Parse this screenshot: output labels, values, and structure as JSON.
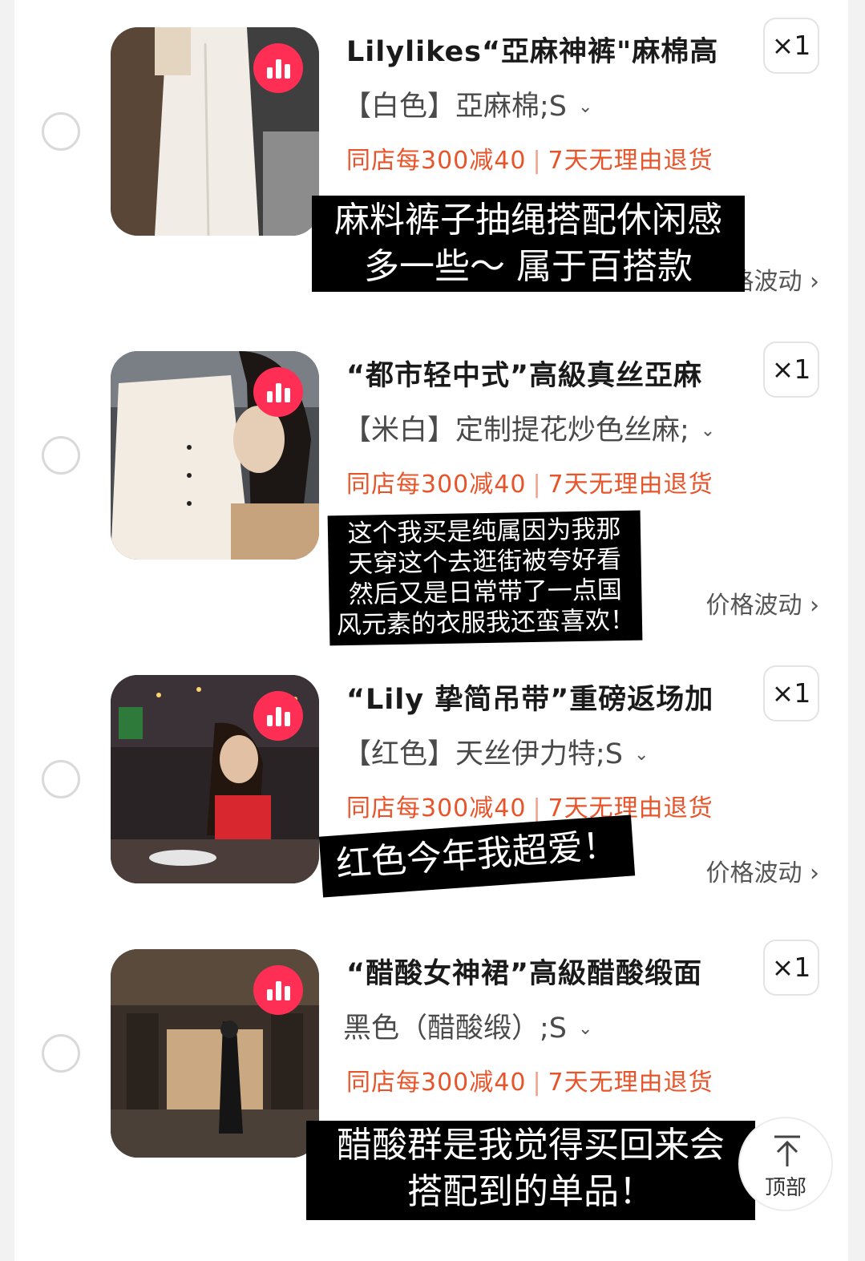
{
  "items": [
    {
      "title": "Lilylikes“亞麻神裤\"麻棉高",
      "variant": "【白色】亞麻棉;S",
      "promo_discount": "同店每300减40",
      "promo_return": "7天无理由退货",
      "quantity": "×1",
      "price_link": "价格波动",
      "note_lines": [
        "麻料裤子抽绳搭配休闲感",
        "多一些～ 属于百搭款"
      ]
    },
    {
      "title": "“都市轻中式”高級真丝亞麻",
      "variant": "【米白】定制提花炒色丝麻;",
      "promo_discount": "同店每300减40",
      "promo_return": "7天无理由退货",
      "quantity": "×1",
      "price_link": "价格波动",
      "note_lines": [
        "这个我买是纯属因为我那",
        "天穿这个去逛街被夸好看",
        "然后又是日常带了一点国",
        "风元素的衣服我还蛮喜欢！"
      ]
    },
    {
      "title": "“Lily 挚简吊带”重磅返场加",
      "variant": "【红色】天丝伊力特;S",
      "promo_discount": "同店每300减40",
      "promo_return": "7天无理由退货",
      "quantity": "×1",
      "price_link": "价格波动",
      "note_lines": [
        "红色今年我超爱！"
      ]
    },
    {
      "title": "“醋酸女神裙”高級醋酸缎面",
      "variant": "黑色（醋酸缎）;S",
      "promo_discount": "同店每300减40",
      "promo_return": "7天无理由退货",
      "quantity": "×1",
      "note_lines": [
        "醋酸群是我觉得买回来会",
        "搭配到的单品！"
      ]
    }
  ],
  "top_button": {
    "label": "顶部"
  },
  "colors": {
    "promo": "#e8542a",
    "badge": "#ff2e55",
    "note_bg": "#000000"
  }
}
